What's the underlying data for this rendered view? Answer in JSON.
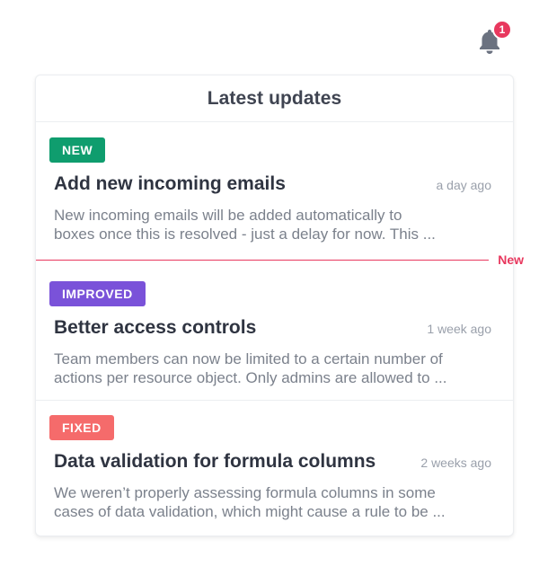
{
  "notifications": {
    "count": "1",
    "icon": "bell-icon",
    "badge_color": "#e8385e"
  },
  "panel": {
    "title": "Latest updates",
    "new_divider_label": "New"
  },
  "updates": [
    {
      "tag": "NEW",
      "tag_color": "#0f9d6e",
      "title": "Add new incoming emails",
      "time": "a day ago",
      "description_line1": "New incoming emails will be added automatically to",
      "description_line2": "boxes once this is resolved - just a delay for now.  This ..."
    },
    {
      "tag": "IMPROVED",
      "tag_color": "#7a52d9",
      "title": "Better access controls",
      "time": "1 week ago",
      "description_line1": "Team members can now be limited to a certain number of",
      "description_line2": "actions per resource object. Only admins are allowed to ..."
    },
    {
      "tag": "FIXED",
      "tag_color": "#f56b6b",
      "title": "Data validation for formula columns",
      "time": "2 weeks ago",
      "description_line1": "We weren’t properly assessing formula columns in some",
      "description_line2": "cases of data validation, which might cause a rule to be ..."
    }
  ]
}
